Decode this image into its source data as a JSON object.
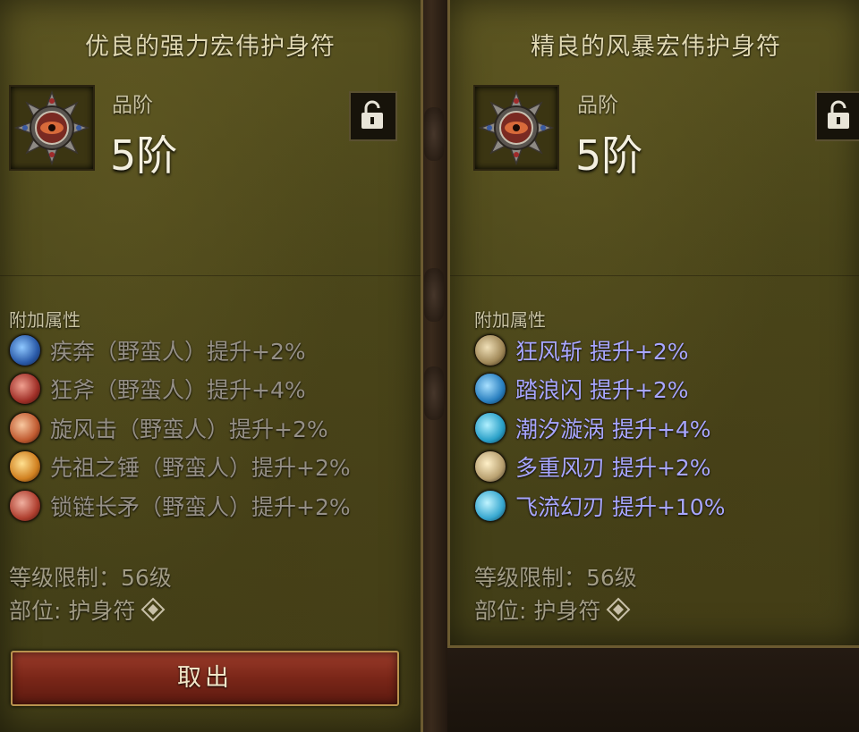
{
  "left_panel": {
    "title": "优良的强力宏伟护身符",
    "grade_label": "品阶",
    "grade_value": "5阶",
    "attr_title": "附加属性",
    "attributes": [
      {
        "text": "疾奔（野蛮人）提升+2%",
        "icon": "sprint-skill-icon",
        "color": "#3a7fd0"
      },
      {
        "text": "狂斧（野蛮人）提升+4%",
        "icon": "frenzy-axe-skill-icon",
        "color": "#c0483a"
      },
      {
        "text": "旋风击（野蛮人）提升+2%",
        "icon": "whirlwind-skill-icon",
        "color": "#c86a3a"
      },
      {
        "text": "先祖之锤（野蛮人）提升+2%",
        "icon": "ancestor-hammer-skill-icon",
        "color": "#d8902a"
      },
      {
        "text": "锁链长矛（野蛮人）提升+2%",
        "icon": "chain-spear-skill-icon",
        "color": "#c05040"
      }
    ],
    "level_req": "等级限制：56级",
    "slot": "部位: 护身符",
    "button": "取出"
  },
  "right_panel": {
    "title": "精良的风暴宏伟护身符",
    "grade_label": "品阶",
    "grade_value": "5阶",
    "attr_title": "附加属性",
    "attributes": [
      {
        "text": "狂风斩  提升+2%",
        "icon": "gale-slash-skill-icon",
        "color": "#b8a880"
      },
      {
        "text": "踏浪闪  提升+2%",
        "icon": "wave-dash-skill-icon",
        "color": "#3a90c8"
      },
      {
        "text": "潮汐漩涡  提升+4%",
        "icon": "tidal-vortex-skill-icon",
        "color": "#3aa0c0"
      },
      {
        "text": "多重风刃  提升+2%",
        "icon": "multi-wind-blade-skill-icon",
        "color": "#c8b888"
      },
      {
        "text": "飞流幻刃  提升+10%",
        "icon": "flowing-blade-skill-icon",
        "color": "#4ab0d0"
      }
    ],
    "level_req": "等级限制：56级",
    "slot": "部位: 护身符"
  }
}
